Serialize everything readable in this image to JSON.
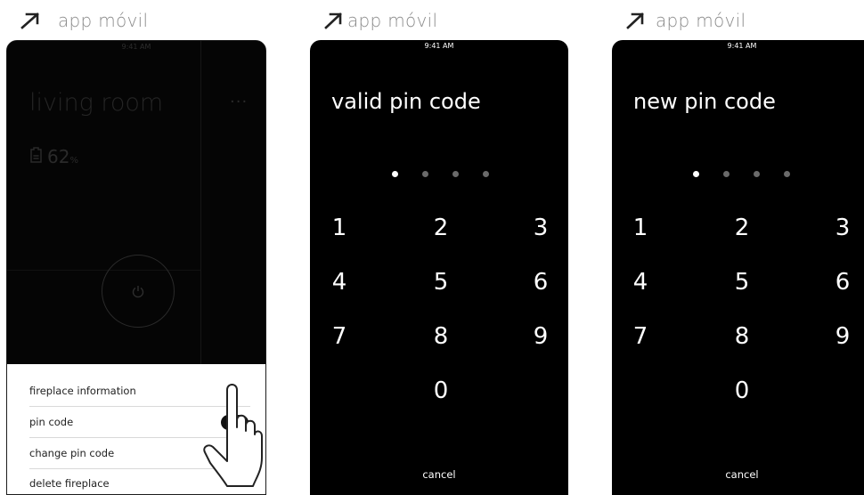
{
  "labels": [
    "app móvil",
    "app móvil",
    "app móvil"
  ],
  "phone1": {
    "time": "9:41 AM",
    "room_title": "living room",
    "more": "···",
    "battery_value": "62",
    "battery_unit": "%",
    "menu": [
      {
        "label": "fireplace information"
      },
      {
        "label": "pin code",
        "toggle": true
      },
      {
        "label": "change pin code"
      },
      {
        "label": "delete fireplace"
      }
    ]
  },
  "phone2": {
    "time": "9:41 AM",
    "title": "valid pin code",
    "filled_digits": 1,
    "keys": [
      "1",
      "2",
      "3",
      "4",
      "5",
      "6",
      "7",
      "8",
      "9",
      "0"
    ],
    "cancel": "cancel"
  },
  "phone3": {
    "time": "9:41 AM",
    "title": "new pin code",
    "filled_digits": 1,
    "keys": [
      "1",
      "2",
      "3",
      "4",
      "5",
      "6",
      "7",
      "8",
      "9",
      "0"
    ],
    "cancel": "cancel"
  },
  "colors": {
    "label_gray": "#8a8a8a",
    "screen_bg": "#000000",
    "toggle_on": "#111111"
  }
}
